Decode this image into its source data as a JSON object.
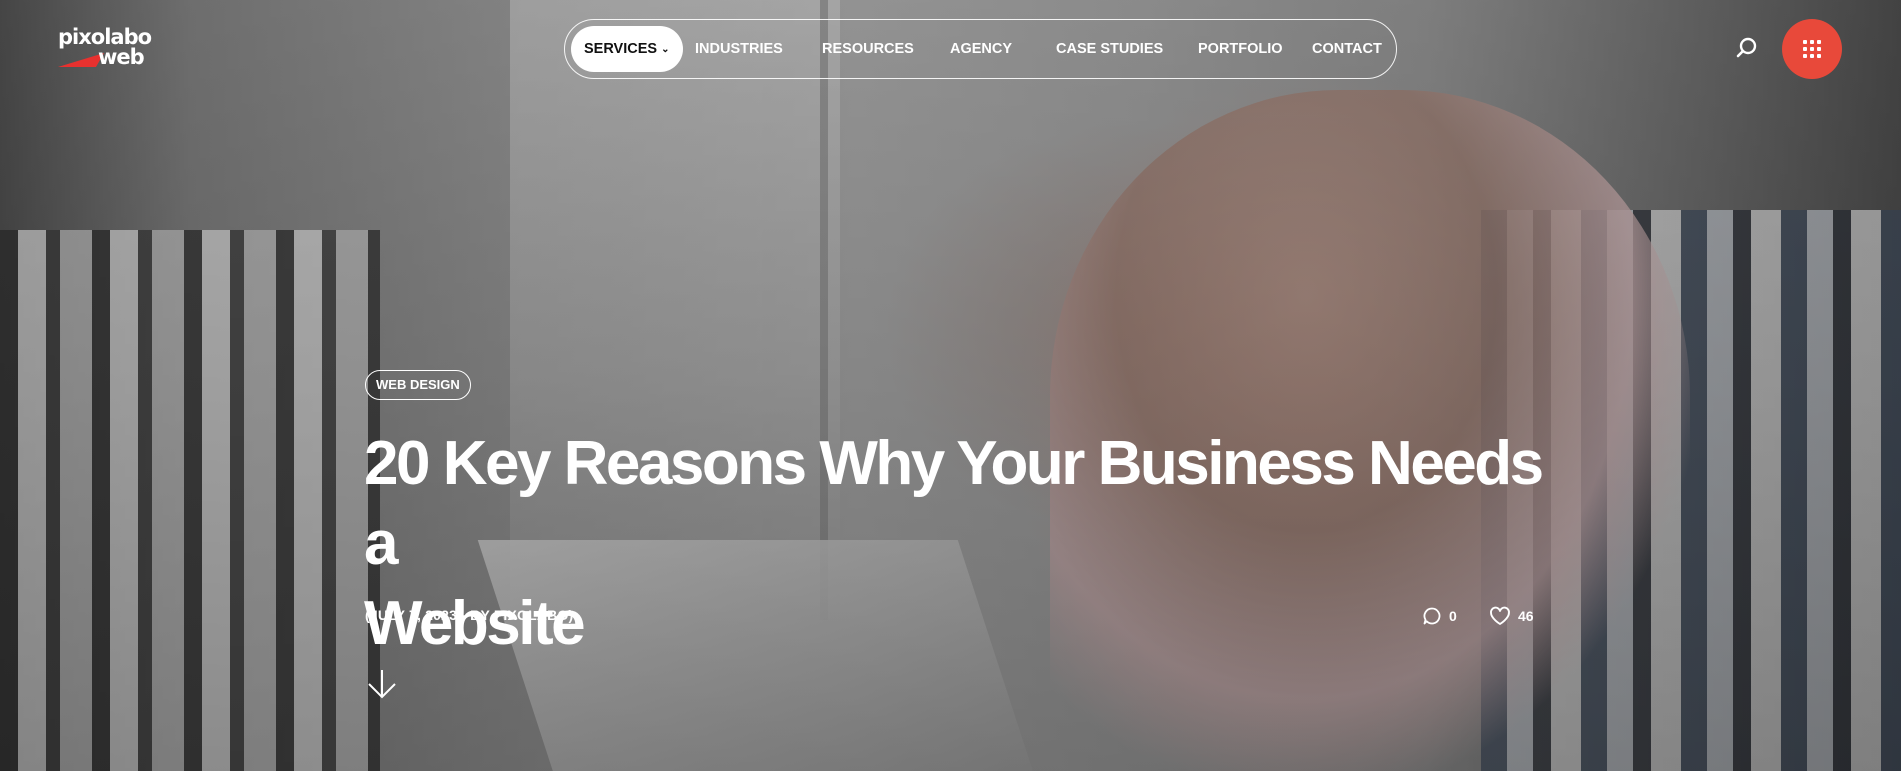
{
  "brand": {
    "logo_line1": "pixolabo",
    "logo_line2": "web",
    "accent_color": "#e8493a"
  },
  "nav": {
    "items": [
      {
        "label": "SERVICES",
        "active": true,
        "has_dropdown": true
      },
      {
        "label": "INDUSTRIES"
      },
      {
        "label": "RESOURCES"
      },
      {
        "label": "AGENCY"
      },
      {
        "label": "CASE STUDIES"
      },
      {
        "label": "PORTFOLIO"
      },
      {
        "label": "CONTACT"
      }
    ]
  },
  "header_actions": {
    "search_icon": "search-icon",
    "menu_icon": "grid-dots-icon"
  },
  "post": {
    "category": "WEB DESIGN",
    "title_line1": "20 Key Reasons Why Your Business Needs a",
    "title_line2": "Website",
    "meta": "(JULY 7, 2023 - BY PIXOLABO)",
    "comments_count": "0",
    "likes_count": "46",
    "comments_icon": "comment-icon",
    "likes_icon": "heart-icon",
    "scroll_icon": "arrow-down-icon"
  }
}
